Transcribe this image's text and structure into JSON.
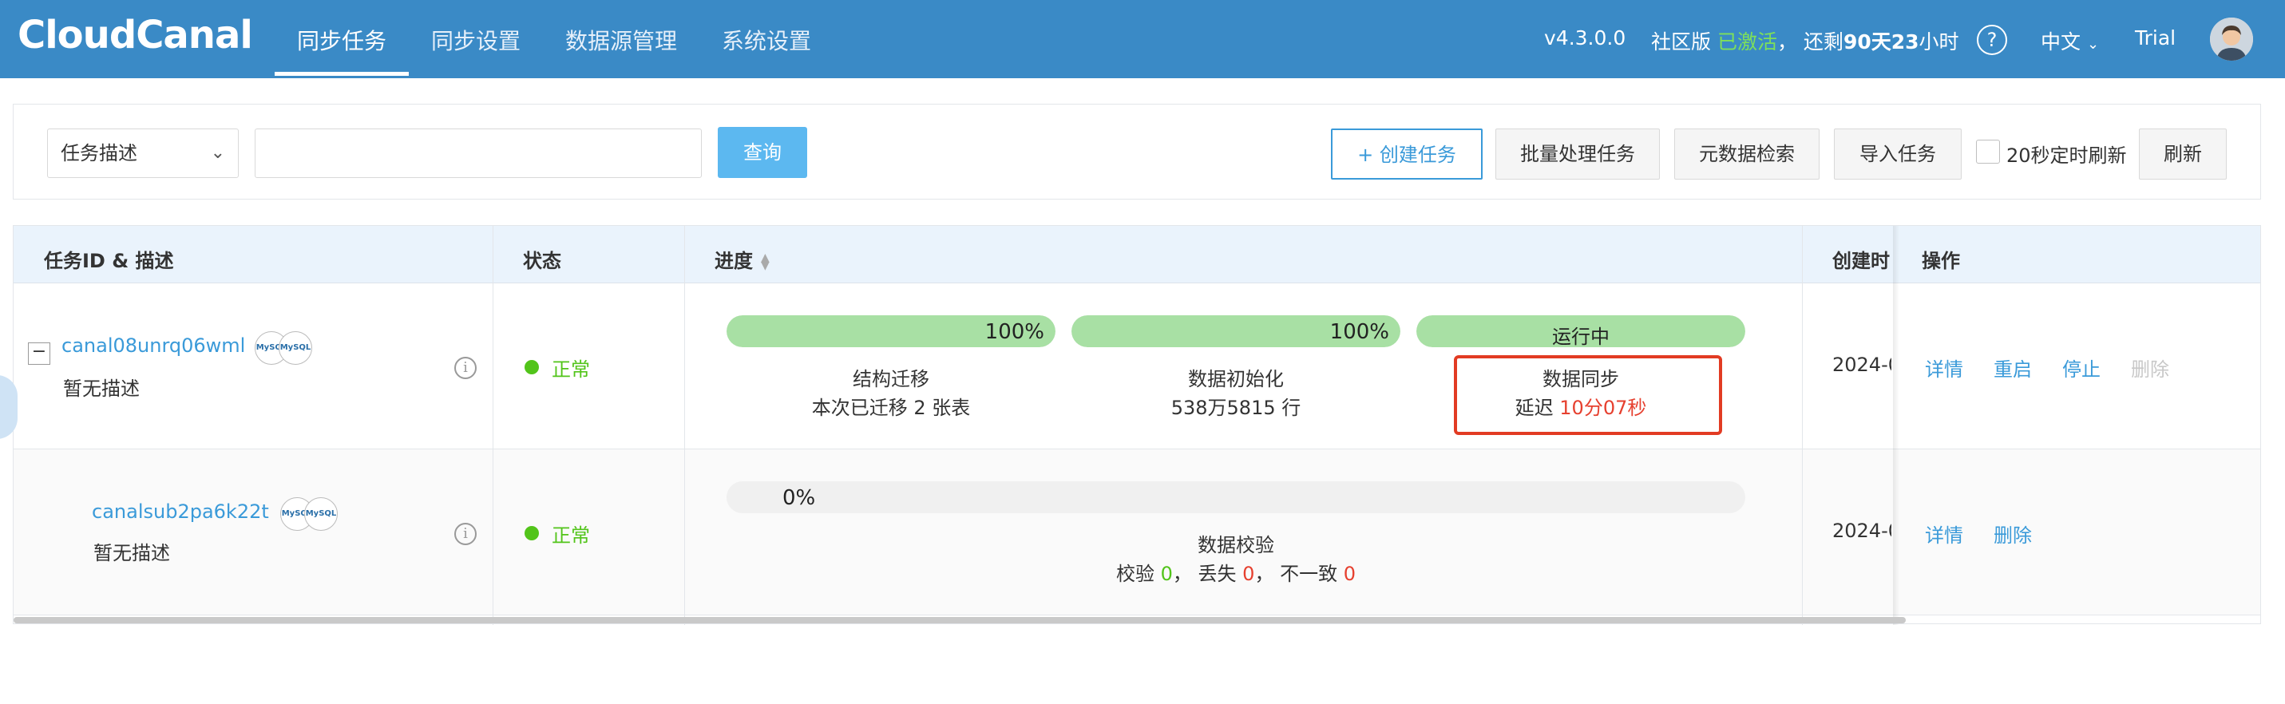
{
  "header": {
    "logo": "CloudCanal",
    "nav": [
      "同步任务",
      "同步设置",
      "数据源管理",
      "系统设置"
    ],
    "version": "v4.3.0.0",
    "edition": "社区版",
    "activated": "已激活",
    "remaining_prefix": "，  还剩",
    "remaining_value": "90天23",
    "remaining_suffix": "小时",
    "help_icon": "help-circle-icon",
    "language": "中文",
    "user": "Trial",
    "brand_color": "#3a8ac6"
  },
  "search": {
    "select_value": "任务描述",
    "input_value": "",
    "query_button": "查询",
    "create_button": "+ 创建任务",
    "batch_button": "批量处理任务",
    "metadata_button": "元数据检索",
    "import_button": "导入任务",
    "auto_refresh_label": "20秒定时刷新",
    "auto_refresh_checked": false,
    "refresh_button": "刷新"
  },
  "table": {
    "headers": {
      "id_desc": "任务ID & 描述",
      "status": "状态",
      "progress": "进度",
      "created": "创建时间",
      "operations": "操作"
    },
    "rows": [
      {
        "expand": "−",
        "task_id": "canal08unrq06wml",
        "description": "暂无描述",
        "status": "正常",
        "stages": [
          {
            "bar_label": "100%",
            "progress": 100,
            "title": "结构迁移",
            "sub": "本次已迁移 2 张表"
          },
          {
            "bar_label": "100%",
            "progress": 100,
            "title": "数据初始化",
            "sub": "538万5815 行"
          },
          {
            "bar_label": "运行中",
            "progress": 100,
            "title": "数据同步",
            "sub_prefix": "延迟 ",
            "sub_value": "10分07秒"
          }
        ],
        "created": "2024-0",
        "ops": [
          "详情",
          "重启",
          "停止",
          "删除"
        ]
      },
      {
        "task_id": "canalsub2pa6k22t",
        "description": "暂无描述",
        "status": "正常",
        "stage": {
          "bar_label": "0%",
          "progress": 0,
          "title": "数据校验",
          "check_label": "校验 ",
          "check_value": "0",
          "lost_label": "，  丢失 ",
          "lost_value": "0",
          "diff_label": "，  不一致 ",
          "diff_value": "0"
        },
        "created": "2024-0",
        "ops": [
          "详情",
          "删除"
        ]
      }
    ]
  }
}
